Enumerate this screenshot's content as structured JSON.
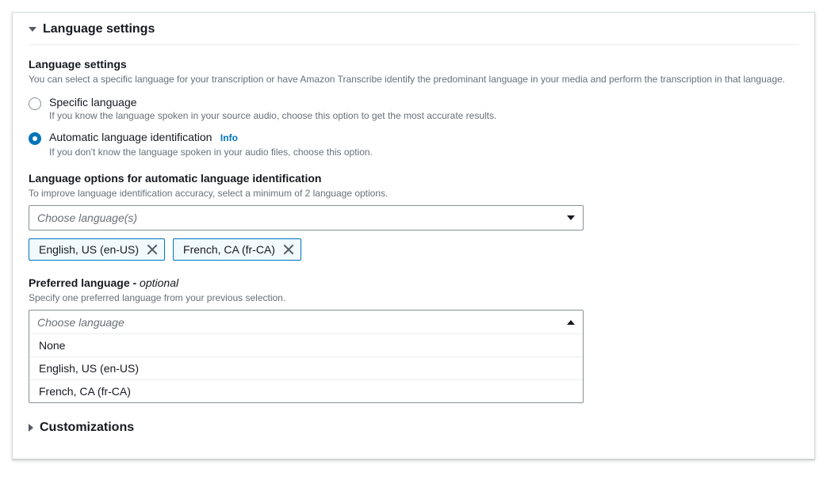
{
  "sections": {
    "language_settings_header": "Language settings",
    "customizations_header": "Customizations"
  },
  "language_settings": {
    "title": "Language settings",
    "description": "You can select a specific language for your transcription or have Amazon Transcribe identify the predominant language in your media and perform the transcription in that language.",
    "radio_specific": {
      "label": "Specific language",
      "description": "If you know the language spoken in your source audio, choose this option to get the most accurate results."
    },
    "radio_auto": {
      "label": "Automatic language identification",
      "info": "Info",
      "description": "If you don't know the language spoken in your audio files, choose this option."
    }
  },
  "language_options": {
    "title": "Language options for automatic language identification",
    "description": "To improve language identification accuracy, select a minimum of 2 language options.",
    "placeholder": "Choose language(s)",
    "tokens": [
      "English, US (en-US)",
      "French, CA (fr-CA)"
    ]
  },
  "preferred_language": {
    "title_main": "Preferred language - ",
    "title_optional": "optional",
    "description": "Specify one preferred language from your previous selection.",
    "placeholder": "Choose language",
    "options": [
      "None",
      "English, US (en-US)",
      "French, CA (fr-CA)"
    ]
  }
}
